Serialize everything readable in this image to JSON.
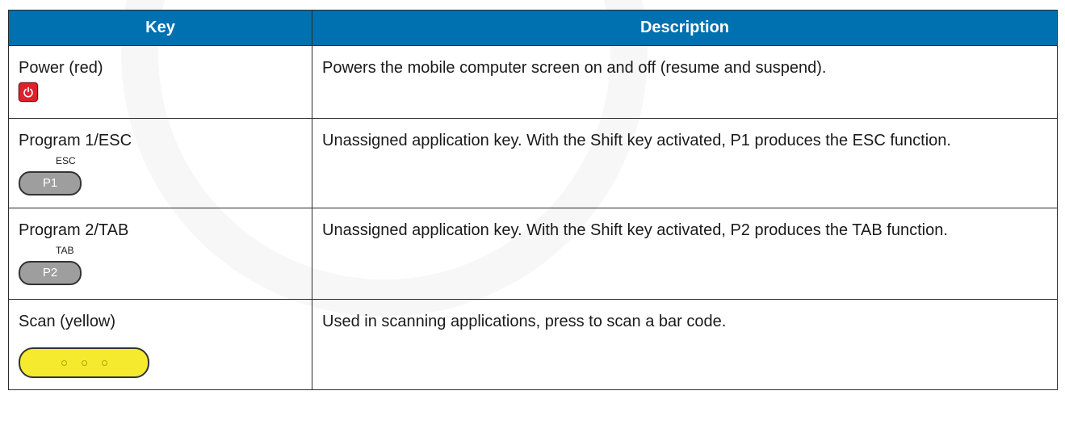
{
  "table": {
    "headers": {
      "key": "Key",
      "description": "Description"
    },
    "rows": [
      {
        "key": "Power (red)",
        "description": "Powers the mobile computer screen on and off (resume and suspend).",
        "icon": "power-icon"
      },
      {
        "key": "Program 1/ESC",
        "description": "Unassigned application key. With the Shift key activated, P1 produces the ESC function.",
        "icon": "p1-key-icon",
        "key_label": "P1",
        "shift_label": "ESC"
      },
      {
        "key": "Program 2/TAB",
        "description": "Unassigned application key. With the Shift key activated, P2 produces the TAB function.",
        "icon": "p2-key-icon",
        "key_label": "P2",
        "shift_label": "TAB"
      },
      {
        "key": "Scan (yellow)",
        "description": "Used in scanning applications, press to scan a bar code.",
        "icon": "scan-key-icon"
      }
    ]
  },
  "colors": {
    "header_bg": "#0071b0",
    "header_text": "#ffffff",
    "power_red": "#e0202a",
    "program_key_gray": "#9e9e9e",
    "scan_yellow": "#f6ea2e"
  }
}
